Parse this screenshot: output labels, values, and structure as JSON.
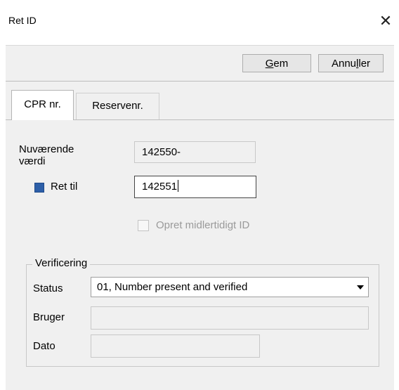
{
  "window": {
    "title": "Ret ID",
    "close_icon": "close-icon"
  },
  "toolbar": {
    "save_pre": "",
    "save_u": "G",
    "save_post": "em",
    "cancel_pre": "Annu",
    "cancel_u": "l",
    "cancel_post": "ler"
  },
  "tabs": [
    {
      "label": "CPR nr.",
      "active": true
    },
    {
      "label": "Reservenr.",
      "active": false
    }
  ],
  "form": {
    "current_label_line1": "Nuværende",
    "current_label_line2": "værdi",
    "current_value": "142550-",
    "retil_label": "Ret til",
    "retil_value": "142551",
    "retil_checked": true,
    "temp_id_label": "Opret midlertidigt ID",
    "temp_id_checked": false
  },
  "verification": {
    "legend": "Verificering",
    "status_label": "Status",
    "status_value": "01, Number present and verified",
    "user_label": "Bruger",
    "user_value": "",
    "date_label": "Dato",
    "date_value": ""
  },
  "colors": {
    "checkbox_checked": "#2d5fa8",
    "panel": "#f0f0f0"
  }
}
